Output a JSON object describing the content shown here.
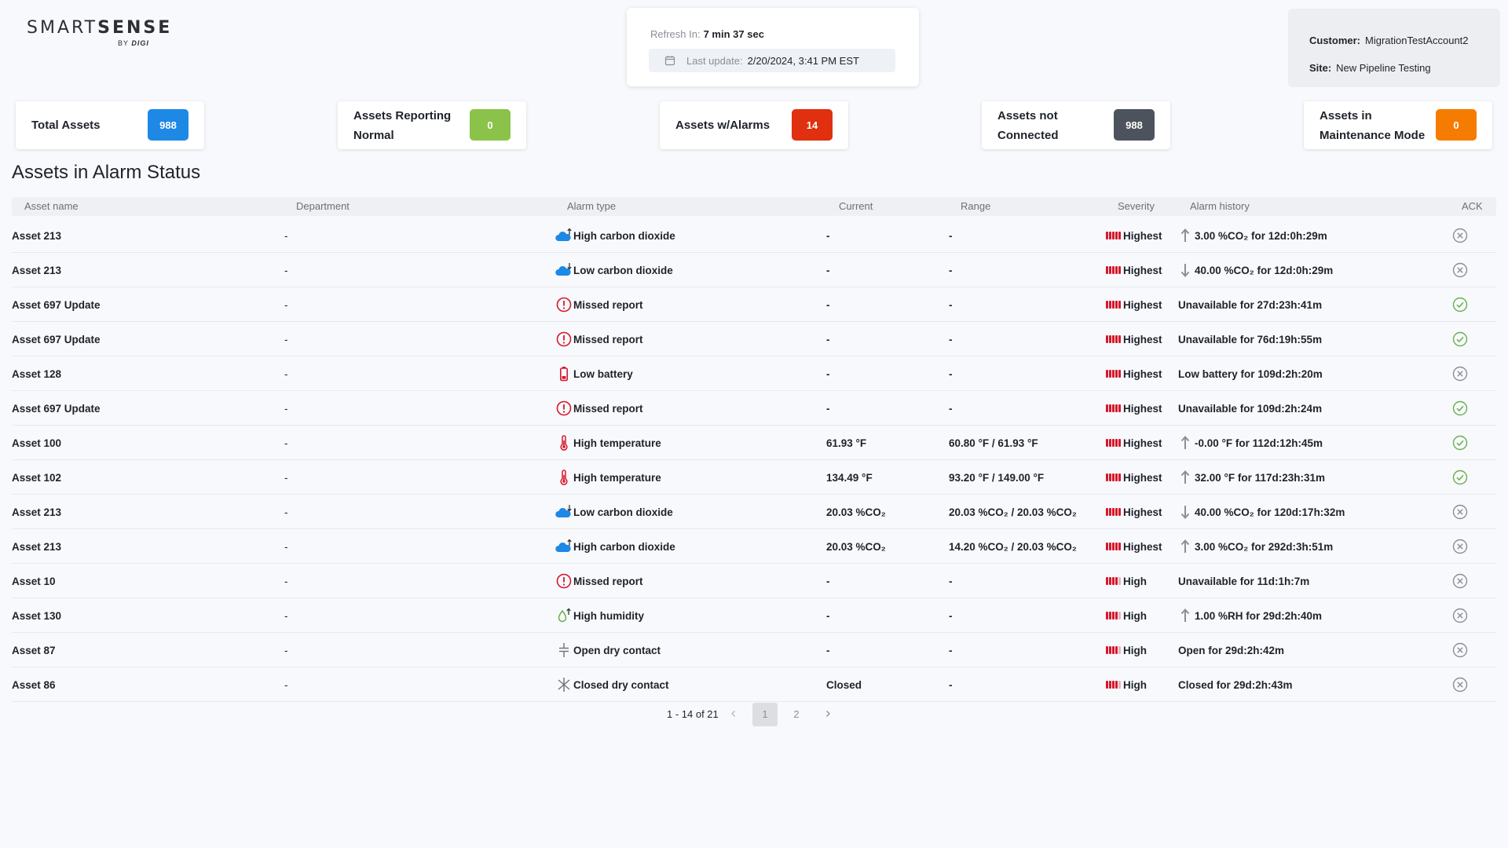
{
  "logo": {
    "brand_light": "SMART",
    "brand_bold": "SENSE",
    "by_prefix": "BY",
    "by_company": "DIGI"
  },
  "refresh": {
    "label": "Refresh In:",
    "value": "7 min 37 sec",
    "last_update_label": "Last update:",
    "last_update_value": "2/20/2024, 3:41 PM EST"
  },
  "customer": {
    "customer_label": "Customer:",
    "customer_value": "MigrationTestAccount2",
    "site_label": "Site:",
    "site_value": "New Pipeline Testing"
  },
  "kpis": [
    {
      "label": "Total Assets",
      "value": "988",
      "color": "#1e88e5"
    },
    {
      "label": "Assets Reporting Normal",
      "value": "0",
      "color": "#8bc34a"
    },
    {
      "label": "Assets w/Alarms",
      "value": "14",
      "color": "#e0300f"
    },
    {
      "label": "Assets not Connected",
      "value": "988",
      "color": "#4d535c"
    },
    {
      "label": "Assets in Maintenance Mode",
      "value": "0",
      "color": "#f57c00"
    }
  ],
  "section_title": "Assets in Alarm Status",
  "columns": [
    "Asset name",
    "Department",
    "Alarm type",
    "Current",
    "Range",
    "Severity",
    "Alarm history",
    "ACK"
  ],
  "rows": [
    {
      "asset": "Asset 213",
      "department": "-",
      "icon": "co2-up-icon",
      "alarm": "High carbon dioxide",
      "current": "-",
      "range": "-",
      "severity": "Highest",
      "history_arrow": "up",
      "history": "3.00 %CO₂ for 12d:0h:29m",
      "ack": "unacknowledged"
    },
    {
      "asset": "Asset 213",
      "department": "-",
      "icon": "co2-down-icon",
      "alarm": "Low carbon dioxide",
      "current": "-",
      "range": "-",
      "severity": "Highest",
      "history_arrow": "down",
      "history": "40.00 %CO₂ for 12d:0h:29m",
      "ack": "unacknowledged"
    },
    {
      "asset": "Asset 697 Update",
      "department": "-",
      "icon": "missed-report-icon",
      "alarm": "Missed report",
      "current": "-",
      "range": "-",
      "severity": "Highest",
      "history_arrow": "none",
      "history": "Unavailable for 27d:23h:41m",
      "ack": "acknowledged"
    },
    {
      "asset": "Asset 697 Update",
      "department": "-",
      "icon": "missed-report-icon",
      "alarm": "Missed report",
      "current": "-",
      "range": "-",
      "severity": "Highest",
      "history_arrow": "none",
      "history": "Unavailable for 76d:19h:55m",
      "ack": "acknowledged"
    },
    {
      "asset": "Asset 128",
      "department": "-",
      "icon": "low-battery-icon",
      "alarm": "Low battery",
      "current": "-",
      "range": "-",
      "severity": "Highest",
      "history_arrow": "none",
      "history": "Low battery for 109d:2h:20m",
      "ack": "unacknowledged"
    },
    {
      "asset": "Asset 697 Update",
      "department": "-",
      "icon": "missed-report-icon",
      "alarm": "Missed report",
      "current": "-",
      "range": "-",
      "severity": "Highest",
      "history_arrow": "none",
      "history": "Unavailable for 109d:2h:24m",
      "ack": "acknowledged"
    },
    {
      "asset": "Asset 100",
      "department": "-",
      "icon": "thermometer-icon",
      "alarm": "High temperature",
      "current": "61.93 °F",
      "range": "60.80 °F / 61.93 °F",
      "severity": "Highest",
      "history_arrow": "up",
      "history": "-0.00 °F for 112d:12h:45m",
      "ack": "acknowledged"
    },
    {
      "asset": "Asset 102",
      "department": "-",
      "icon": "thermometer-icon",
      "alarm": "High temperature",
      "current": "134.49 °F",
      "range": "93.20 °F / 149.00 °F",
      "severity": "Highest",
      "history_arrow": "up",
      "history": "32.00 °F for 117d:23h:31m",
      "ack": "acknowledged"
    },
    {
      "asset": "Asset 213",
      "department": "-",
      "icon": "co2-down-icon",
      "alarm": "Low carbon dioxide",
      "current": "20.03 %CO₂",
      "range": "20.03 %CO₂ / 20.03 %CO₂",
      "severity": "Highest",
      "history_arrow": "down",
      "history": "40.00 %CO₂ for 120d:17h:32m",
      "ack": "unacknowledged"
    },
    {
      "asset": "Asset 213",
      "department": "-",
      "icon": "co2-up-icon",
      "alarm": "High carbon dioxide",
      "current": "20.03 %CO₂",
      "range": "14.20 %CO₂ / 20.03 %CO₂",
      "severity": "Highest",
      "history_arrow": "up",
      "history": "3.00 %CO₂ for 292d:3h:51m",
      "ack": "unacknowledged"
    },
    {
      "asset": "Asset 10",
      "department": "-",
      "icon": "missed-report-icon",
      "alarm": "Missed report",
      "current": "-",
      "range": "-",
      "severity": "High",
      "history_arrow": "none",
      "history": "Unavailable for 11d:1h:7m",
      "ack": "unacknowledged"
    },
    {
      "asset": "Asset 130",
      "department": "-",
      "icon": "humidity-icon",
      "alarm": "High humidity",
      "current": "-",
      "range": "-",
      "severity": "High",
      "history_arrow": "up",
      "history": "1.00 %RH for 29d:2h:40m",
      "ack": "unacknowledged"
    },
    {
      "asset": "Asset 87",
      "department": "-",
      "icon": "open-contact-icon",
      "alarm": "Open dry contact",
      "current": "-",
      "range": "-",
      "severity": "High",
      "history_arrow": "none",
      "history": "Open for 29d:2h:42m",
      "ack": "unacknowledged"
    },
    {
      "asset": "Asset 86",
      "department": "-",
      "icon": "closed-contact-icon",
      "alarm": "Closed dry contact",
      "current": "Closed",
      "range": "-",
      "severity": "High",
      "history_arrow": "none",
      "history": "Closed for 29d:2h:43m",
      "ack": "unacknowledged"
    }
  ],
  "pagination": {
    "range": "1 - 14 of 21",
    "pages": [
      "1",
      "2"
    ],
    "current": "1"
  }
}
